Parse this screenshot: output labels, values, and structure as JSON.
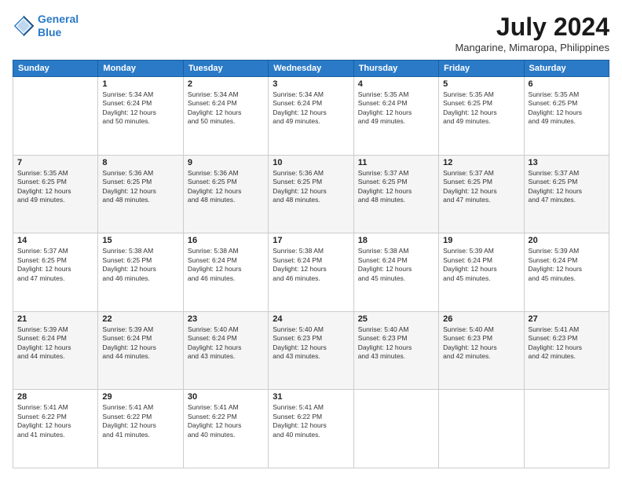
{
  "header": {
    "logo_line1": "General",
    "logo_line2": "Blue",
    "month_year": "July 2024",
    "location": "Mangarine, Mimaropa, Philippines"
  },
  "days_of_week": [
    "Sunday",
    "Monday",
    "Tuesday",
    "Wednesday",
    "Thursday",
    "Friday",
    "Saturday"
  ],
  "weeks": [
    [
      {
        "day": "",
        "info": ""
      },
      {
        "day": "1",
        "info": "Sunrise: 5:34 AM\nSunset: 6:24 PM\nDaylight: 12 hours\nand 50 minutes."
      },
      {
        "day": "2",
        "info": "Sunrise: 5:34 AM\nSunset: 6:24 PM\nDaylight: 12 hours\nand 50 minutes."
      },
      {
        "day": "3",
        "info": "Sunrise: 5:34 AM\nSunset: 6:24 PM\nDaylight: 12 hours\nand 49 minutes."
      },
      {
        "day": "4",
        "info": "Sunrise: 5:35 AM\nSunset: 6:24 PM\nDaylight: 12 hours\nand 49 minutes."
      },
      {
        "day": "5",
        "info": "Sunrise: 5:35 AM\nSunset: 6:25 PM\nDaylight: 12 hours\nand 49 minutes."
      },
      {
        "day": "6",
        "info": "Sunrise: 5:35 AM\nSunset: 6:25 PM\nDaylight: 12 hours\nand 49 minutes."
      }
    ],
    [
      {
        "day": "7",
        "info": "Sunrise: 5:35 AM\nSunset: 6:25 PM\nDaylight: 12 hours\nand 49 minutes."
      },
      {
        "day": "8",
        "info": "Sunrise: 5:36 AM\nSunset: 6:25 PM\nDaylight: 12 hours\nand 48 minutes."
      },
      {
        "day": "9",
        "info": "Sunrise: 5:36 AM\nSunset: 6:25 PM\nDaylight: 12 hours\nand 48 minutes."
      },
      {
        "day": "10",
        "info": "Sunrise: 5:36 AM\nSunset: 6:25 PM\nDaylight: 12 hours\nand 48 minutes."
      },
      {
        "day": "11",
        "info": "Sunrise: 5:37 AM\nSunset: 6:25 PM\nDaylight: 12 hours\nand 48 minutes."
      },
      {
        "day": "12",
        "info": "Sunrise: 5:37 AM\nSunset: 6:25 PM\nDaylight: 12 hours\nand 47 minutes."
      },
      {
        "day": "13",
        "info": "Sunrise: 5:37 AM\nSunset: 6:25 PM\nDaylight: 12 hours\nand 47 minutes."
      }
    ],
    [
      {
        "day": "14",
        "info": "Sunrise: 5:37 AM\nSunset: 6:25 PM\nDaylight: 12 hours\nand 47 minutes."
      },
      {
        "day": "15",
        "info": "Sunrise: 5:38 AM\nSunset: 6:25 PM\nDaylight: 12 hours\nand 46 minutes."
      },
      {
        "day": "16",
        "info": "Sunrise: 5:38 AM\nSunset: 6:24 PM\nDaylight: 12 hours\nand 46 minutes."
      },
      {
        "day": "17",
        "info": "Sunrise: 5:38 AM\nSunset: 6:24 PM\nDaylight: 12 hours\nand 46 minutes."
      },
      {
        "day": "18",
        "info": "Sunrise: 5:38 AM\nSunset: 6:24 PM\nDaylight: 12 hours\nand 45 minutes."
      },
      {
        "day": "19",
        "info": "Sunrise: 5:39 AM\nSunset: 6:24 PM\nDaylight: 12 hours\nand 45 minutes."
      },
      {
        "day": "20",
        "info": "Sunrise: 5:39 AM\nSunset: 6:24 PM\nDaylight: 12 hours\nand 45 minutes."
      }
    ],
    [
      {
        "day": "21",
        "info": "Sunrise: 5:39 AM\nSunset: 6:24 PM\nDaylight: 12 hours\nand 44 minutes."
      },
      {
        "day": "22",
        "info": "Sunrise: 5:39 AM\nSunset: 6:24 PM\nDaylight: 12 hours\nand 44 minutes."
      },
      {
        "day": "23",
        "info": "Sunrise: 5:40 AM\nSunset: 6:24 PM\nDaylight: 12 hours\nand 43 minutes."
      },
      {
        "day": "24",
        "info": "Sunrise: 5:40 AM\nSunset: 6:23 PM\nDaylight: 12 hours\nand 43 minutes."
      },
      {
        "day": "25",
        "info": "Sunrise: 5:40 AM\nSunset: 6:23 PM\nDaylight: 12 hours\nand 43 minutes."
      },
      {
        "day": "26",
        "info": "Sunrise: 5:40 AM\nSunset: 6:23 PM\nDaylight: 12 hours\nand 42 minutes."
      },
      {
        "day": "27",
        "info": "Sunrise: 5:41 AM\nSunset: 6:23 PM\nDaylight: 12 hours\nand 42 minutes."
      }
    ],
    [
      {
        "day": "28",
        "info": "Sunrise: 5:41 AM\nSunset: 6:22 PM\nDaylight: 12 hours\nand 41 minutes."
      },
      {
        "day": "29",
        "info": "Sunrise: 5:41 AM\nSunset: 6:22 PM\nDaylight: 12 hours\nand 41 minutes."
      },
      {
        "day": "30",
        "info": "Sunrise: 5:41 AM\nSunset: 6:22 PM\nDaylight: 12 hours\nand 40 minutes."
      },
      {
        "day": "31",
        "info": "Sunrise: 5:41 AM\nSunset: 6:22 PM\nDaylight: 12 hours\nand 40 minutes."
      },
      {
        "day": "",
        "info": ""
      },
      {
        "day": "",
        "info": ""
      },
      {
        "day": "",
        "info": ""
      }
    ]
  ]
}
